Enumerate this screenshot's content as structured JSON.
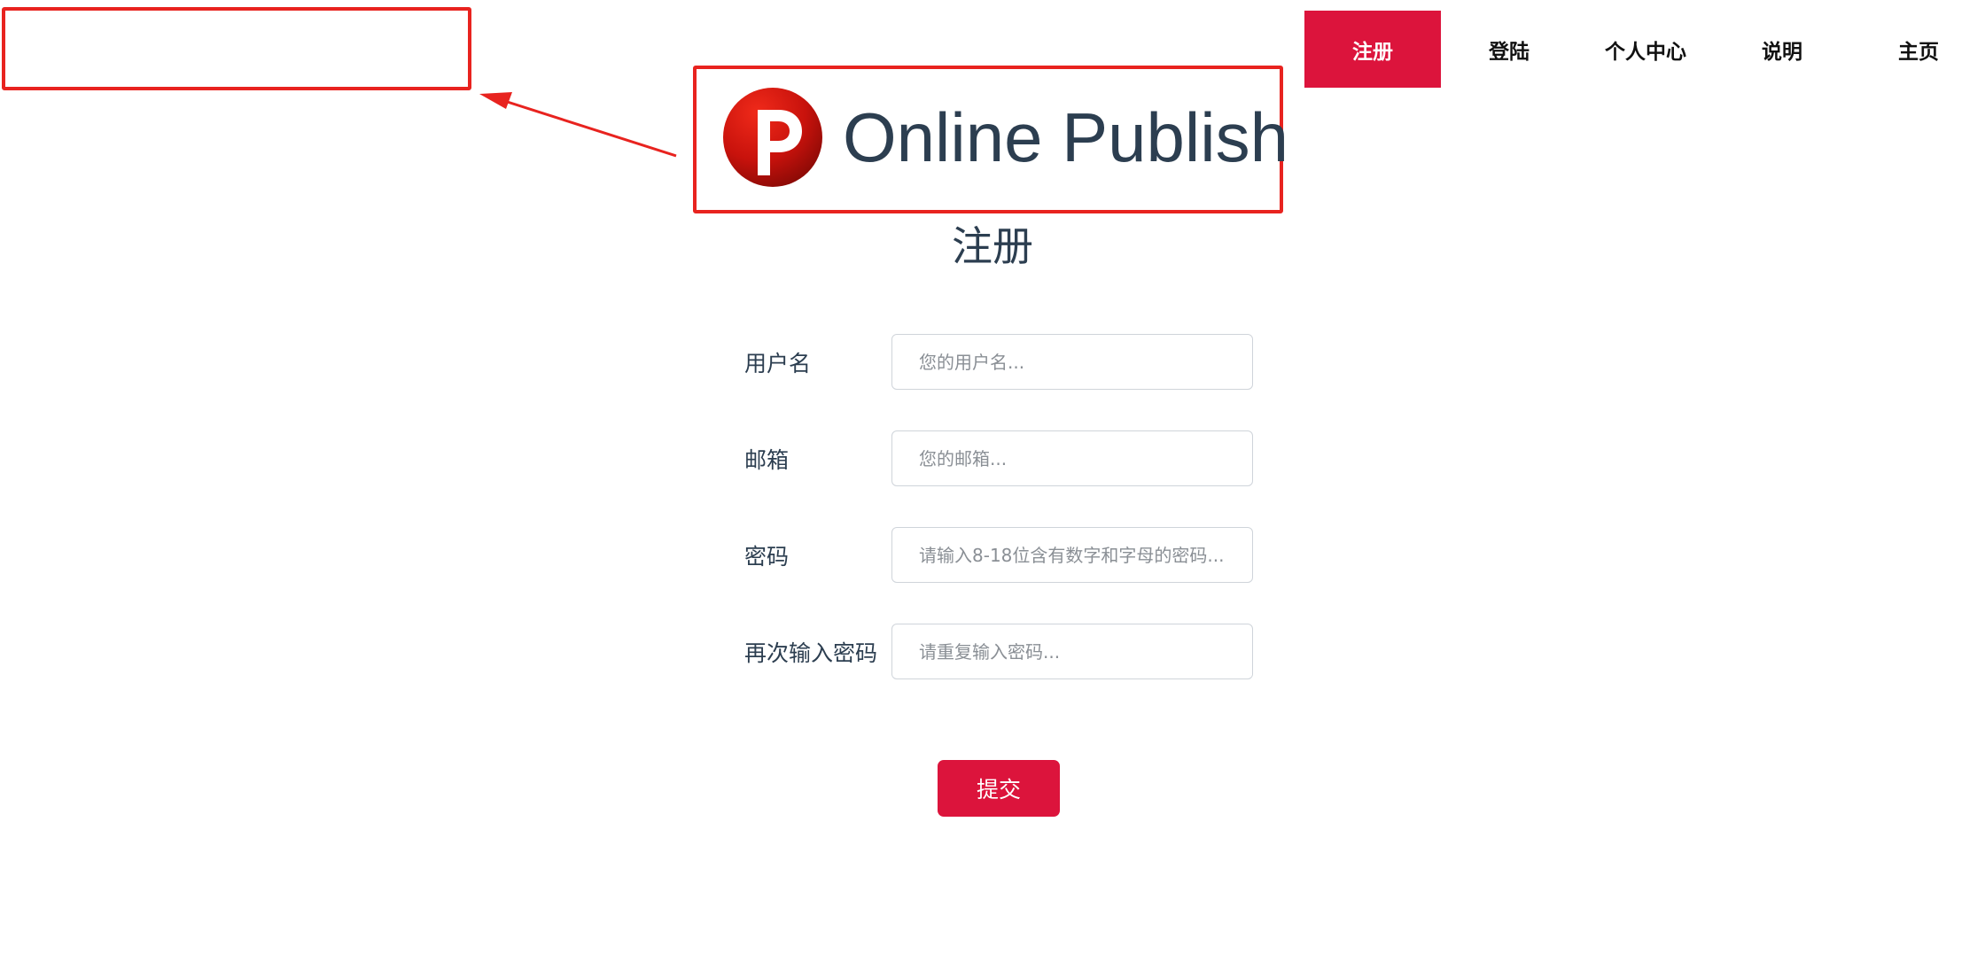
{
  "nav": {
    "items": [
      {
        "label": "注册",
        "active": true
      },
      {
        "label": "登陆",
        "active": false
      },
      {
        "label": "个人中心",
        "active": false
      },
      {
        "label": "说明",
        "active": false
      },
      {
        "label": "主页",
        "active": false
      }
    ]
  },
  "logo": {
    "text": "Online Publish",
    "icon": "publish-p-icon"
  },
  "page": {
    "title": "注册"
  },
  "form": {
    "username": {
      "label": "用户名",
      "placeholder": "您的用户名...",
      "value": ""
    },
    "email": {
      "label": "邮箱",
      "placeholder": "您的邮箱...",
      "value": ""
    },
    "password": {
      "label": "密码",
      "placeholder": "请输入8-18位含有数字和字母的密码...",
      "value": ""
    },
    "confirm_password": {
      "label": "再次输入密码",
      "placeholder": "请重复输入密码...",
      "value": ""
    },
    "submit_label": "提交"
  },
  "colors": {
    "accent": "#dc143c",
    "annotation": "#e8231f",
    "text": "#2c3e50"
  }
}
